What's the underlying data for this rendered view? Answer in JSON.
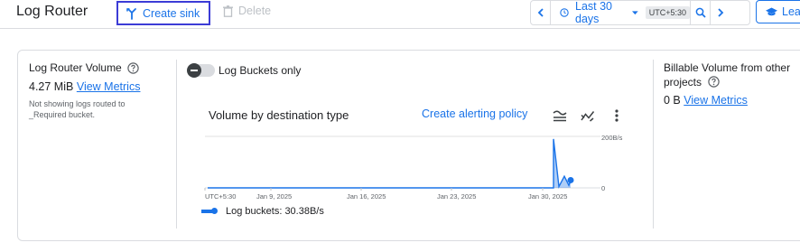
{
  "header": {
    "title": "Log Router",
    "create_sink_label": "Create sink",
    "delete_label": "Delete",
    "time_range_label": "Last 30 days",
    "timezone_badge": "UTC+5:30",
    "learn_label": "Lear"
  },
  "volume": {
    "title": "Log Router Volume",
    "value": "4.27 MiB",
    "link_label": "View Metrics",
    "note": "Not showing logs routed to _Required bucket."
  },
  "toggle": {
    "label": "Log Buckets only",
    "checked": false
  },
  "chart": {
    "title": "Volume by destination type",
    "alert_link": "Create alerting policy",
    "legend_label": "Log buckets:",
    "legend_value": "30.38B/s"
  },
  "billable": {
    "title": "Billable Volume from other projects",
    "value": "0 B",
    "link_label": "View Metrics"
  },
  "colors": {
    "accent": "#1a73e8",
    "highlight_border": "#3c3cd6"
  },
  "chart_data": {
    "type": "area",
    "title": "Volume by destination type",
    "xlabel": "",
    "ylabel": "",
    "x_ticks": [
      "UTC+5:30",
      "Jan 9, 2025",
      "Jan 16, 2025",
      "Jan 23, 2025",
      "Jan 30, 2025"
    ],
    "y_ticks": [
      "200B/s",
      "0"
    ],
    "ylim": [
      0,
      200
    ],
    "grid": true,
    "legend": "bottom-left",
    "series": [
      {
        "name": "Log buckets",
        "x": [
          "Jan 2",
          "Jan 29",
          "Jan 29",
          "Jan 30",
          "Jan 30",
          "Jan 31",
          "Jan 31"
        ],
        "values": [
          0,
          0,
          190,
          5,
          45,
          10,
          30
        ]
      }
    ]
  }
}
